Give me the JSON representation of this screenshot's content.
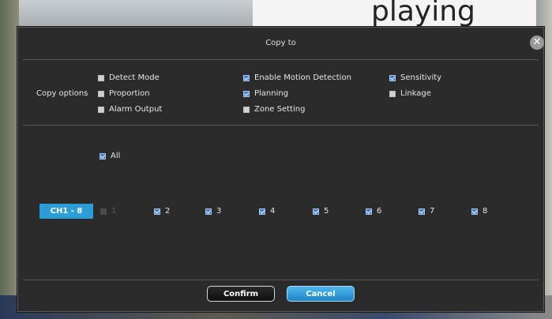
{
  "background": {
    "sign_text": "playing"
  },
  "dialog": {
    "title": "Copy to",
    "close_symbol": "✕"
  },
  "copy_options": {
    "label": "Copy options",
    "items": [
      {
        "label": "Detect Mode",
        "checked": false
      },
      {
        "label": "Enable Motion Detection",
        "checked": true
      },
      {
        "label": "Sensitivity",
        "checked": true
      },
      {
        "label": "Proportion",
        "checked": false
      },
      {
        "label": "Planning",
        "checked": true
      },
      {
        "label": "Linkage",
        "checked": false
      },
      {
        "label": "Alarm Output",
        "checked": false
      },
      {
        "label": "Zone Setting",
        "checked": false
      }
    ]
  },
  "channels": {
    "all_label": "All",
    "all_checked": true,
    "group_button": "CH1 - 8",
    "items": [
      {
        "label": "1",
        "checked": false,
        "disabled": true
      },
      {
        "label": "2",
        "checked": true,
        "disabled": false
      },
      {
        "label": "3",
        "checked": true,
        "disabled": false
      },
      {
        "label": "4",
        "checked": true,
        "disabled": false
      },
      {
        "label": "5",
        "checked": true,
        "disabled": false
      },
      {
        "label": "6",
        "checked": true,
        "disabled": false
      },
      {
        "label": "7",
        "checked": true,
        "disabled": false
      },
      {
        "label": "8",
        "checked": true,
        "disabled": false
      }
    ]
  },
  "buttons": {
    "confirm": "Confirm",
    "cancel": "Cancel"
  },
  "colors": {
    "accent": "#2d9dd7",
    "checkbox_on": "#3c7fd1",
    "dialog_bg": "#2b2b2b"
  }
}
